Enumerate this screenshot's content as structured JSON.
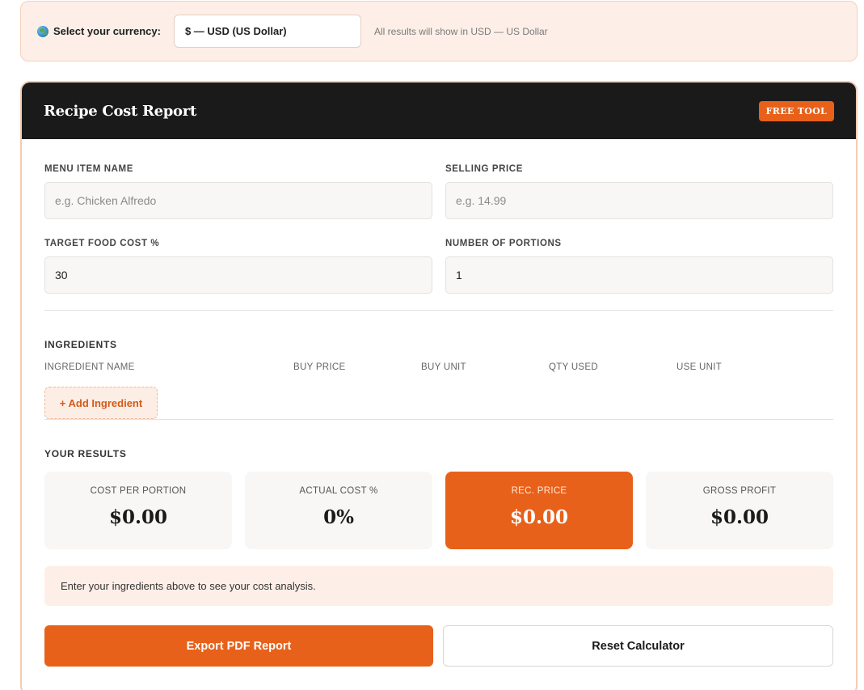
{
  "currency": {
    "label": "Select your currency:",
    "selected": "$ — USD (US Dollar)",
    "note": "All results will show in USD — US Dollar"
  },
  "header": {
    "title": "Recipe Cost Report",
    "badge": "FREE TOOL"
  },
  "form": {
    "menu_item": {
      "label": "MENU ITEM NAME",
      "placeholder": "e.g. Chicken Alfredo",
      "value": ""
    },
    "selling_price": {
      "label": "SELLING PRICE",
      "placeholder": "e.g. 14.99",
      "value": ""
    },
    "target_cost": {
      "label": "TARGET FOOD COST %",
      "value": "30"
    },
    "portions": {
      "label": "NUMBER OF PORTIONS",
      "value": "1"
    }
  },
  "ingredients": {
    "title": "INGREDIENTS",
    "columns": [
      "INGREDIENT NAME",
      "BUY PRICE",
      "BUY UNIT",
      "QTY USED",
      "USE UNIT"
    ],
    "add_label": "+ Add Ingredient"
  },
  "results": {
    "title": "YOUR RESULTS",
    "items": [
      {
        "label": "COST PER PORTION",
        "value": "$0.00"
      },
      {
        "label": "ACTUAL COST %",
        "value": "0%"
      },
      {
        "label": "REC. PRICE",
        "value": "$0.00"
      },
      {
        "label": "GROSS PROFIT",
        "value": "$0.00"
      }
    ],
    "message": "Enter your ingredients above to see your cost analysis."
  },
  "actions": {
    "export_label": "Export PDF Report",
    "reset_label": "Reset Calculator"
  },
  "colors": {
    "accent": "#e8611a",
    "header_bg": "#1a1a1a",
    "soft_bg": "#fdefe7"
  }
}
